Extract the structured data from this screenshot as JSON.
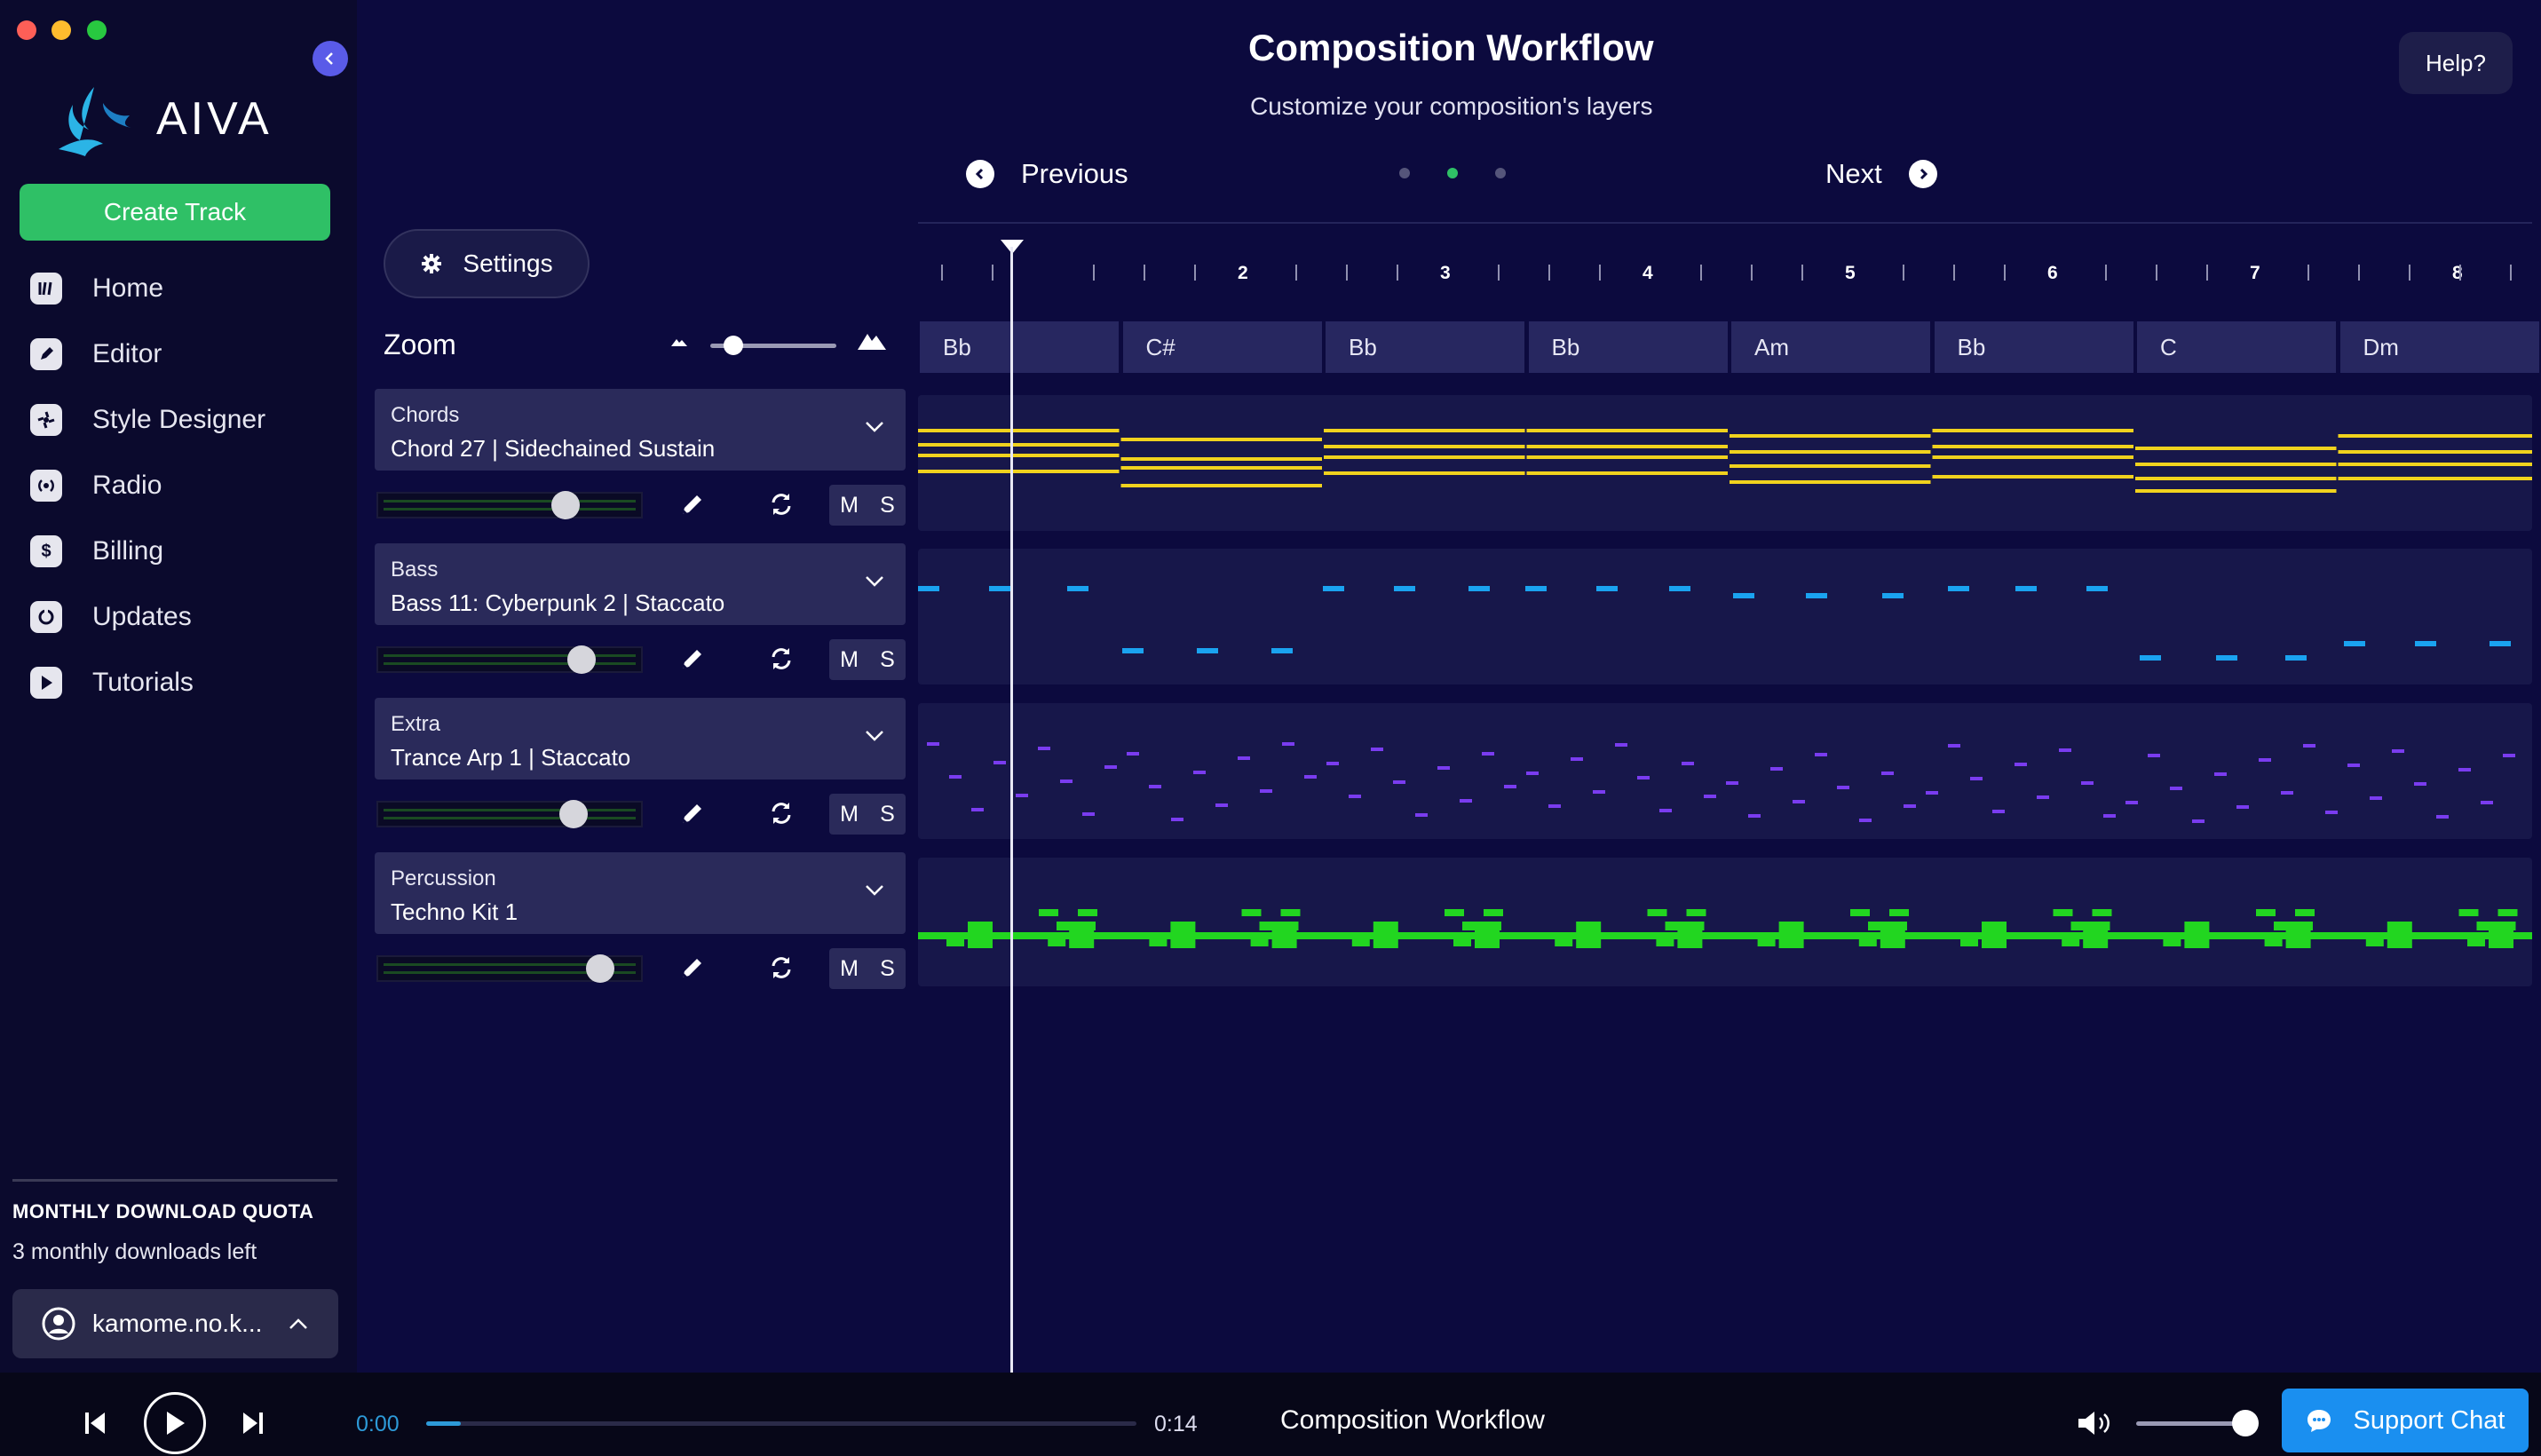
{
  "app": {
    "logo_text": "AIVA",
    "create_button": "Create Track"
  },
  "sidebar": {
    "items": [
      {
        "label": "Home",
        "icon": "home-icon"
      },
      {
        "label": "Editor",
        "icon": "pencil-icon"
      },
      {
        "label": "Style Designer",
        "icon": "style-designer-icon"
      },
      {
        "label": "Radio",
        "icon": "radio-icon"
      },
      {
        "label": "Billing",
        "icon": "dollar-icon"
      },
      {
        "label": "Updates",
        "icon": "updates-icon"
      },
      {
        "label": "Tutorials",
        "icon": "play-icon"
      }
    ],
    "quota_title": "MONTHLY DOWNLOAD QUOTA",
    "quota_text": "3 monthly downloads left",
    "user_name": "kamome.no.k..."
  },
  "header": {
    "title": "Composition Workflow",
    "subtitle": "Customize your composition's layers",
    "help": "Help?",
    "previous": "Previous",
    "next": "Next",
    "step_active": 2,
    "step_count": 3
  },
  "controls": {
    "settings": "Settings",
    "zoom": "Zoom",
    "zoom_level": 0.15
  },
  "tracks": [
    {
      "category": "Chords",
      "instrument": "Chord 27 | Sidechained Sustain",
      "volume": 0.71,
      "mute": "M",
      "solo": "S"
    },
    {
      "category": "Bass",
      "instrument": "Bass 11: Cyberpunk 2 | Staccato",
      "volume": 0.77,
      "mute": "M",
      "solo": "S"
    },
    {
      "category": "Extra",
      "instrument": "Trance Arp 1 | Staccato",
      "volume": 0.74,
      "mute": "M",
      "solo": "S"
    },
    {
      "category": "Percussion",
      "instrument": "Techno Kit 1",
      "volume": 0.84,
      "mute": "M",
      "solo": "S"
    }
  ],
  "timeline": {
    "bars": [
      "2",
      "3",
      "4",
      "5",
      "6",
      "7",
      "8"
    ],
    "chords": [
      "Bb",
      "C#",
      "Bb",
      "Bb",
      "Am",
      "Bb",
      "C",
      "Dm"
    ]
  },
  "player": {
    "time_start": "0:00",
    "time_end": "0:14",
    "progress": 0.035,
    "title": "Composition Workflow",
    "volume": 0.9,
    "support": "Support Chat"
  },
  "colors": {
    "accent_green": "#2fc066",
    "chords_notes": "#f0d21e",
    "bass_notes": "#1aa3f0",
    "extra_notes": "#7a3cf0",
    "percussion_notes": "#22d620",
    "support_blue": "#1a8ff0"
  }
}
